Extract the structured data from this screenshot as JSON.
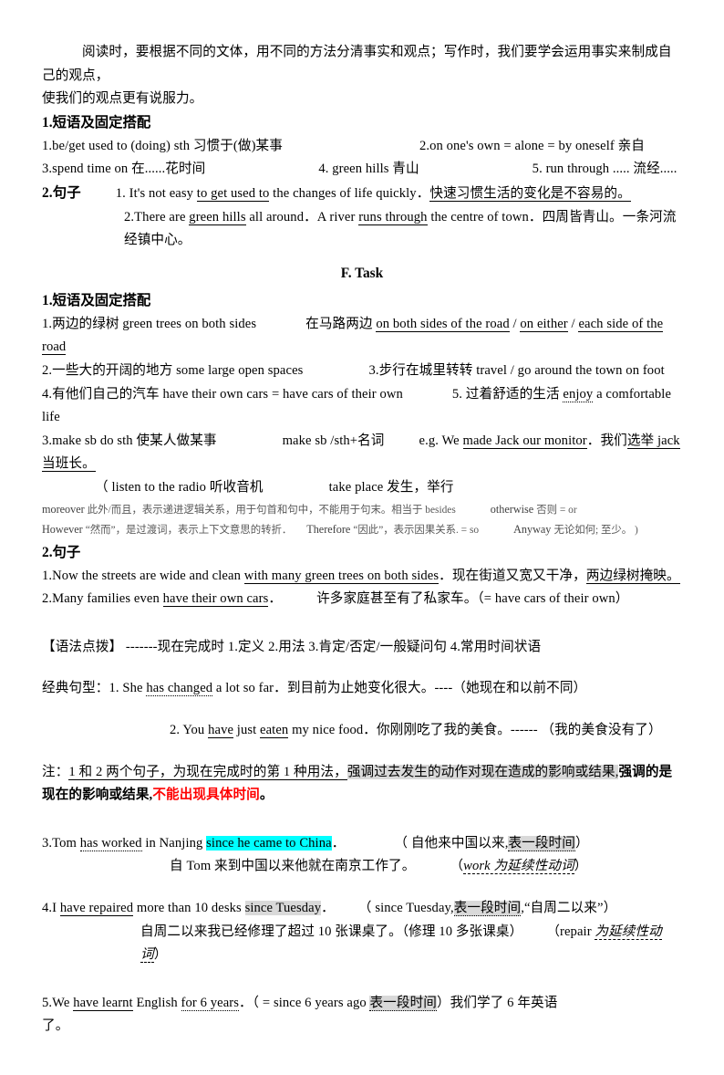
{
  "intro": {
    "line1": "阅读时，要根据不同的文体，用不同的方法分清事实和观点；写作时，我们要学会运用事实来制成自己的观点，",
    "line2": "使我们的观点更有说服力。"
  },
  "section_a": {
    "heading": "1.短语及固定搭配",
    "items": [
      {
        "left": "1.be/get used to (doing) sth  习惯于(做)某事",
        "right": "2.on one's own = alone = by oneself  亲自"
      },
      {
        "left": "3.spend time on 在......花时间",
        "mid": "4. green hills 青山",
        "right": "5. run through ..... 流经....."
      }
    ],
    "sentences_heading": "2.句子",
    "sentence1": {
      "num": "1. ",
      "pre": "It's not easy ",
      "underline1": "to get used to",
      "mid": " the changes of life quickly．",
      "cn_underline": "快速习惯生活的变化是不容易的。"
    },
    "sentence2": {
      "num": "2.",
      "pre": "There are ",
      "underline1": "green hills",
      "mid": " all around．A river ",
      "underline2": "runs through",
      "post": " the centre of town．四周皆青山。一条河流经镇中心。"
    }
  },
  "task": {
    "title": "F. Task",
    "heading": "1.短语及固定搭配",
    "line1": {
      "cn": "1.两边的绿树  green trees on both sides",
      "mid": "在马路两边 ",
      "u1": "on both sides of the road",
      "sep1": " / ",
      "u2": "on either",
      "sep2": " / ",
      "u3": "each side of the road"
    },
    "line2": {
      "left": "2.一些大的开阔的地方  some large open spaces",
      "right": "3.步行在城里转转 travel / go around the town on foot"
    },
    "line3": {
      "left": "4.有他们自己的汽车 have  their own cars = have cars of their own",
      "right_pre": "5. 过着舒适的生活  ",
      "right_u": "enjoy",
      "right_post": " a comfortable life"
    },
    "line4": {
      "a": "3.make sb do sth  使某人做某事",
      "b": "make sb /sth+名词",
      "c": "e.g.  We ",
      "u1": "made Jack our monitor",
      "d": "．我们",
      "u2": "选举 jack 当班长。"
    },
    "paren_line": {
      "open": "（  listen to the radio  听收音机",
      "second": "take place   发生，举行"
    },
    "connectives": {
      "l1_en": "moreover ",
      "l1_cn": "此外/而且，表示递进逻辑关系，用于句首和句中，不能用于句末。相当于 besides",
      "l1_en2": "otherwise ",
      "l1_cn2": "否则 = or",
      "l2_en": "However ",
      "l2_cn": "“然而”，是过渡词，表示上下文意思的转折．",
      "l2_en2": "Therefore ",
      "l2_cn2": "“因此”，表示因果关系. = so",
      "l2_en3": "Anyway ",
      "l2_cn3": "无论如何; 至少。  )"
    },
    "sentences_heading": "2.句子",
    "sentence1": {
      "pre": "1.Now the streets are wide and clean ",
      "u1": "with many green trees on both sides",
      "mid": "．现在街道又宽又干净，",
      "u2": "两边绿树掩映。"
    },
    "sentence2": {
      "pre": "2.Many families even ",
      "u1": "have their own cars",
      "post": "．",
      "cn": "许多家庭甚至有了私家车。（= have cars of their own）"
    }
  },
  "grammar": {
    "header": "【语法点拨】 -------现在完成时  1.定义    2.用法     3.肯定/否定/一般疑问句      4.常用时间状语",
    "classic_label": "经典句型：",
    "example1": {
      "num": "1. ",
      "pre": "She ",
      "u1": "has changed",
      "post": " a lot so far．到目前为止她变化很大。----（她现在和以前不同）"
    },
    "example2": {
      "num": "2. ",
      "pre": "You ",
      "u1": "have",
      "mid": " just ",
      "u2": "eaten",
      "post": " my nice food．你刚刚吃了我的美食。------  （我的美食没有了）"
    },
    "note": {
      "label": "注：",
      "u1": "1 和 2 两个句子，为现在完成时的第 1 种用法，",
      "hl": "强调过去发生的动作对现在造成的影响或结果,",
      "bold": "强调的是现在的影响或结果,",
      "red": "不能出现具体时间",
      "end": "。"
    },
    "examples": [
      {
        "id": "ex3",
        "num": "3.Tom ",
        "u1": "has worked",
        "mid": " in Nanjing ",
        "hl_cyan": "since he came to China",
        "post": "．",
        "paren_open": "（ 自他来中国以来,",
        "hl_gray": "表一段时间",
        "paren_close": "）",
        "cn_line": "自 Tom 来到中国以来他就在南京工作了。",
        "cn_paren_open": "（",
        "cn_ital": "work  为延续性动词",
        "cn_paren_close": "）"
      },
      {
        "id": "ex4",
        "num": "4.I ",
        "u1": "have repaired",
        "mid": " more than 10 desks ",
        "hl_gray1": "since Tuesday",
        "post": "．",
        "paren_open": "（ since Tuesday,",
        "hl_gray2": "表一段时间",
        "paren_mid": ",“自周二以来",
        "paren_close": "”）",
        "cn_line": "自周二以来我已经修理了超过 10 张课桌了。（修理 10 多张课桌）",
        "cn_paren_open": "（repair ",
        "cn_ital": "为延续性动词",
        "cn_paren_close": "）"
      },
      {
        "id": "ex5",
        "num": "5.We ",
        "u1": "have learnt",
        "mid": " English ",
        "u2": "for 6 years",
        "post": "．（ = since 6 years ago ",
        "hl_gray": "表一段时间",
        "paren_close": "）我们学了 6 年英语",
        "cn_end": "了。"
      }
    ]
  },
  "colors": {
    "highlight_cyan": "#00ffff",
    "highlight_gray": "#d9d9d9",
    "red_text": "#ff0000",
    "gray_text": "#595959"
  }
}
